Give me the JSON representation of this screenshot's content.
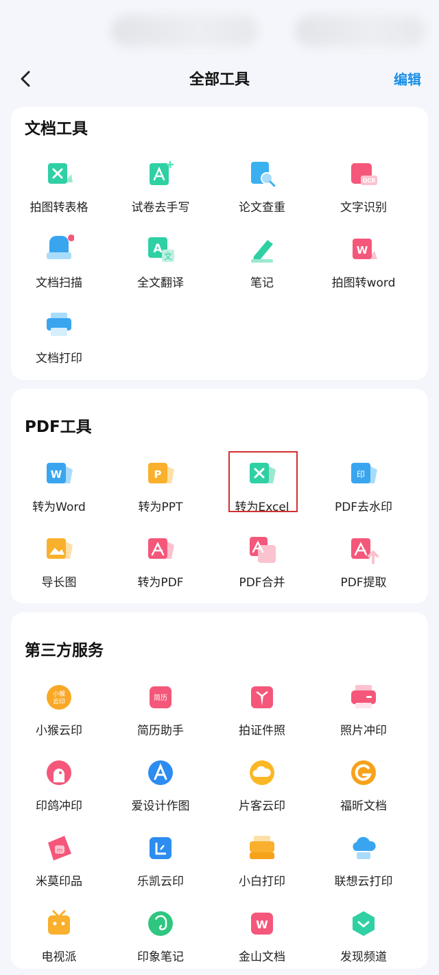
{
  "header": {
    "title": "全部工具",
    "edit_label": "编辑"
  },
  "sections": [
    {
      "title": "文档工具",
      "items": [
        {
          "label": "拍图转表格",
          "icon": "table-photo-icon"
        },
        {
          "label": "试卷去手写",
          "icon": "remove-handwriting-icon"
        },
        {
          "label": "论文查重",
          "icon": "paper-check-icon"
        },
        {
          "label": "文字识别",
          "icon": "ocr-icon"
        },
        {
          "label": "文档扫描",
          "icon": "scan-icon"
        },
        {
          "label": "全文翻译",
          "icon": "translate-icon"
        },
        {
          "label": "笔记",
          "icon": "note-icon"
        },
        {
          "label": "拍图转word",
          "icon": "photo-word-icon"
        },
        {
          "label": "文档打印",
          "icon": "print-icon"
        }
      ]
    },
    {
      "title": "PDF工具",
      "items": [
        {
          "label": "转为Word",
          "icon": "to-word-icon"
        },
        {
          "label": "转为PPT",
          "icon": "to-ppt-icon"
        },
        {
          "label": "转为Excel",
          "icon": "to-excel-icon"
        },
        {
          "label": "PDF去水印",
          "icon": "remove-watermark-icon"
        },
        {
          "label": "导长图",
          "icon": "long-image-icon"
        },
        {
          "label": "转为PDF",
          "icon": "to-pdf-icon"
        },
        {
          "label": "PDF合并",
          "icon": "pdf-merge-icon"
        },
        {
          "label": "PDF提取",
          "icon": "pdf-extract-icon"
        }
      ]
    },
    {
      "title": "第三方服务",
      "items": [
        {
          "label": "小猴云印",
          "icon": "xiaohou-print-icon",
          "glyph": "小猴\n云印"
        },
        {
          "label": "简历助手",
          "icon": "resume-icon",
          "glyph": "简历"
        },
        {
          "label": "拍证件照",
          "icon": "id-photo-icon"
        },
        {
          "label": "照片冲印",
          "icon": "photo-print-icon"
        },
        {
          "label": "印鸽冲印",
          "icon": "yinge-print-icon"
        },
        {
          "label": "爱设计作图",
          "icon": "design-icon"
        },
        {
          "label": "片客云印",
          "icon": "cloud-print-icon"
        },
        {
          "label": "福昕文档",
          "icon": "foxit-icon"
        },
        {
          "label": "米莫印品",
          "icon": "mimo-print-icon"
        },
        {
          "label": "乐凯云印",
          "icon": "lekai-print-icon"
        },
        {
          "label": "小白打印",
          "icon": "xiaobai-printer-icon"
        },
        {
          "label": "联想云打印",
          "icon": "lenovo-cloud-print-icon"
        },
        {
          "label": "电视派",
          "icon": "tv-icon"
        },
        {
          "label": "印象笔记",
          "icon": "evernote-icon"
        },
        {
          "label": "金山文档",
          "icon": "kingsoft-docs-icon"
        },
        {
          "label": "发现频道",
          "icon": "discover-icon"
        }
      ]
    }
  ],
  "colors": {
    "accent": "#1a8fe6",
    "highlight_border": "#d32f2f",
    "background": "#f4f6fb"
  }
}
